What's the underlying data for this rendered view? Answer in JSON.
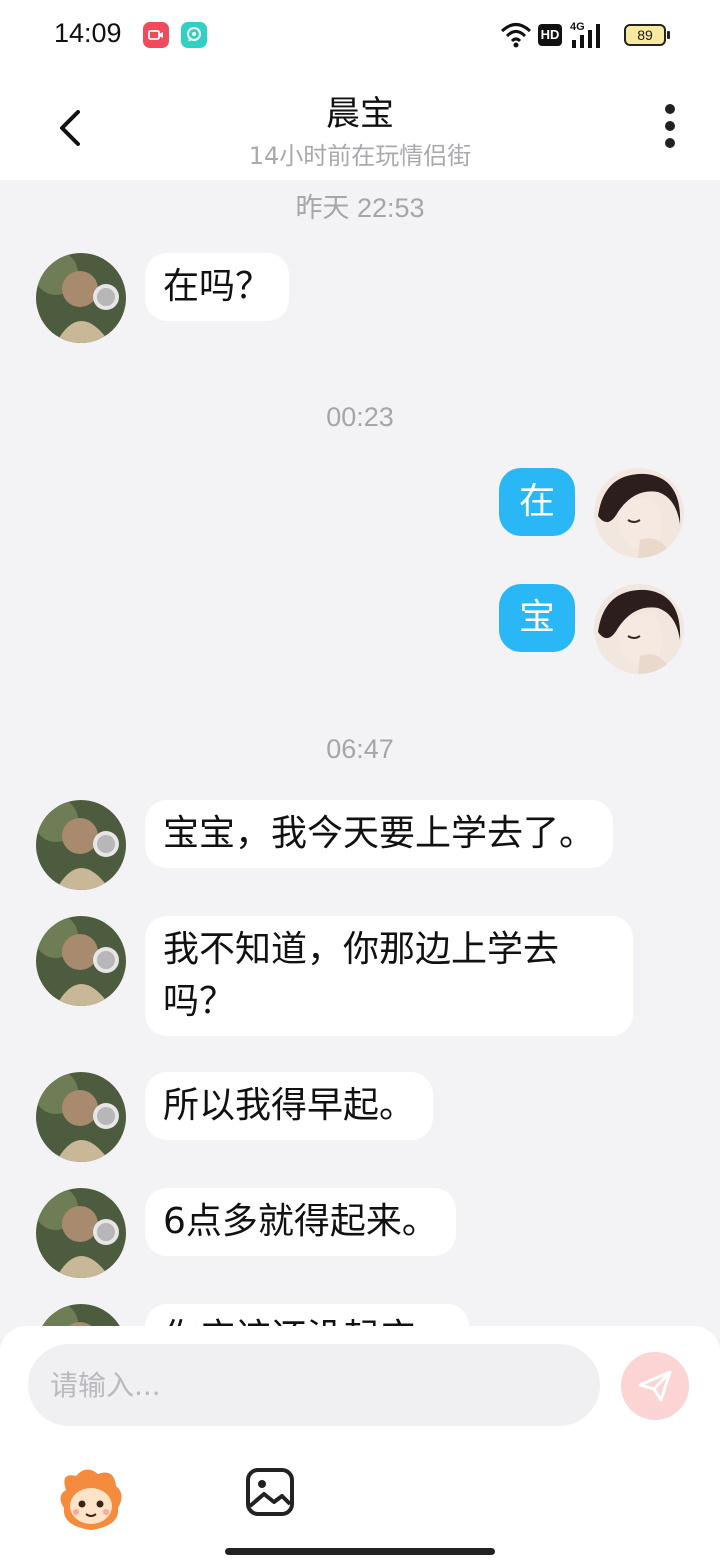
{
  "status_bar": {
    "time": "14:09",
    "battery": "89",
    "network": "4G",
    "hd": "HD"
  },
  "header": {
    "title": "晨宝",
    "subtitle": "14小时前在玩情侣街"
  },
  "messages": [
    {
      "type": "time",
      "text": "昨天 22:53"
    },
    {
      "type": "in",
      "text": "在吗？"
    },
    {
      "type": "time",
      "text": "00:23"
    },
    {
      "type": "out",
      "text": "在"
    },
    {
      "type": "out",
      "text": "宝"
    },
    {
      "type": "time",
      "text": "06:47"
    },
    {
      "type": "in",
      "text": "宝宝，我今天要上学去了。"
    },
    {
      "type": "in",
      "text": "我不知道，你那边上学去吗？"
    },
    {
      "type": "in",
      "text": "所以我得早起。"
    },
    {
      "type": "in",
      "text": "6点多就得起来。"
    },
    {
      "type": "in",
      "text": "你应该还没起床。"
    }
  ],
  "input": {
    "placeholder": "请输入..."
  },
  "colors": {
    "outgoing_bubble": "#29b8f5",
    "incoming_bubble": "#ffffff",
    "background": "#f3f3f6",
    "send_button": "#fcd4d4"
  },
  "icons": {
    "back": "chevron-left-icon",
    "more": "more-vertical-icon",
    "send": "paper-plane-icon",
    "mascot": "mascot-icon",
    "image": "image-icon"
  }
}
